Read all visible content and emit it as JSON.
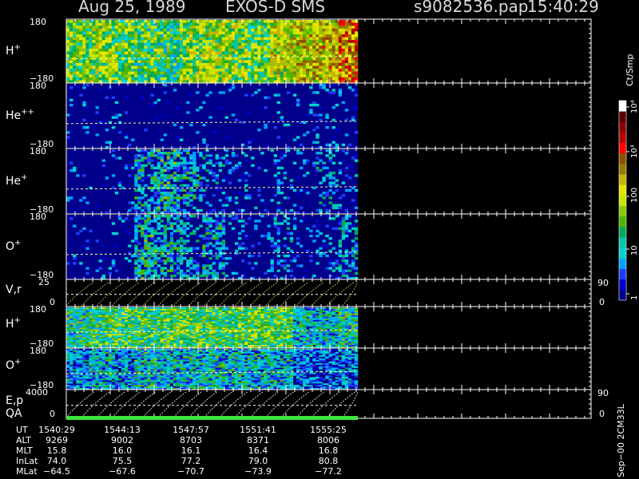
{
  "header": {
    "date": "Aug 25, 1989",
    "instrument": "EXOS-D SMS",
    "filename": "s9082536.pap",
    "time": "15:40:29"
  },
  "colorbar": {
    "unit": "Ct/Smp",
    "ticks": [
      "1",
      "10",
      "100",
      "10³",
      "10⁴"
    ],
    "colors": [
      "#00008b",
      "#0000cd",
      "#1e3cff",
      "#00a0ff",
      "#00d2d2",
      "#00c8aa",
      "#00aa5a",
      "#50b400",
      "#8cc800",
      "#c8e600",
      "#e6e600",
      "#c8b400",
      "#967800",
      "#8c5000",
      "#ff0000",
      "#b40000",
      "#8b0000",
      "#5a0000",
      "#ffffff"
    ]
  },
  "panels": [
    {
      "id": "h-plus",
      "label": "H",
      "sup": "+",
      "ytop": "180",
      "ybot": "−180"
    },
    {
      "id": "he-plus-plus",
      "label": "He",
      "sup": "++",
      "ytop": "180",
      "ybot": "−180"
    },
    {
      "id": "he-plus",
      "label": "He",
      "sup": "+",
      "ytop": "180",
      "ybot": "−180"
    },
    {
      "id": "o-plus",
      "label": "O",
      "sup": "+",
      "ytop": "180",
      "ybot": "−180"
    },
    {
      "id": "vr",
      "label": "V,r",
      "sup": "",
      "ytop": "25",
      "ybot": "0",
      "right_top": "90",
      "right_bot": "0"
    },
    {
      "id": "h-plus-2",
      "label": "H",
      "sup": "+",
      "ytop": "180",
      "ybot": "−180"
    },
    {
      "id": "o-plus-2",
      "label": "O",
      "sup": "+",
      "ytop": "180",
      "ybot": "−180"
    },
    {
      "id": "ep",
      "label": "E,p",
      "sup": "",
      "ytop": "4000",
      "ybot": "0",
      "right_top": "90",
      "right_bot": "0"
    }
  ],
  "qa_label": "QA",
  "orbit_table": {
    "labels": [
      "UT",
      "ALT",
      "MLT",
      "InLat",
      "MLat"
    ],
    "columns": [
      [
        "1540:29",
        "9269",
        "15.8",
        "74.0",
        "−64.5"
      ],
      [
        "1544:13",
        "9002",
        "16.0",
        "75.5",
        "−67.6"
      ],
      [
        "1547:57",
        "8703",
        "16.1",
        "77.2",
        "−70.7"
      ],
      [
        "1551:41",
        "8371",
        "16.4",
        "79.0",
        "−73.9"
      ],
      [
        "1555:25",
        "8006",
        "16.8",
        "80.8",
        "−77.2"
      ]
    ]
  },
  "footer_vertical": "Sep−00 2CM33L",
  "chart_data": {
    "type": "heatmap",
    "title": "Aug 25, 1989   EXOS-D SMS",
    "x_tick_labels_ut": [
      "1540:29",
      "1544:13",
      "1547:57",
      "1551:41",
      "1555:25"
    ],
    "panels": [
      {
        "name": "H+",
        "ylim": [
          -180,
          180
        ],
        "relative_intensity": [
          0.55,
          0.6,
          0.55,
          0.5,
          0.45,
          0.6,
          0.65,
          0.6,
          0.55,
          0.7,
          0.75,
          0.8,
          0.95
        ]
      },
      {
        "name": "He++",
        "ylim": [
          -180,
          180
        ],
        "relative_intensity": [
          0.05,
          0.05,
          0.06,
          0.05,
          0.05,
          0.05,
          0.06,
          0.05,
          0.05,
          0.06,
          0.1,
          0.12,
          0.1
        ]
      },
      {
        "name": "He+",
        "ylim": [
          -180,
          180
        ],
        "relative_intensity": [
          0.05,
          0.05,
          0.1,
          0.3,
          0.35,
          0.3,
          0.2,
          0.15,
          0.1,
          0.15,
          0.1,
          0.2,
          0.1
        ]
      },
      {
        "name": "O+",
        "ylim": [
          -180,
          180
        ],
        "relative_intensity": [
          0.05,
          0.05,
          0.1,
          0.35,
          0.3,
          0.25,
          0.3,
          0.15,
          0.1,
          0.2,
          0.1,
          0.15,
          0.25
        ]
      },
      {
        "name": "H+ (2)",
        "ylim": [
          -180,
          180
        ],
        "relative_intensity": [
          0.4,
          0.45,
          0.5,
          0.45,
          0.5,
          0.55,
          0.5,
          0.5,
          0.55,
          0.5,
          0.3,
          0.3,
          0.4
        ]
      },
      {
        "name": "O+ (2)",
        "ylim": [
          -180,
          180
        ],
        "relative_intensity": [
          0.2,
          0.3,
          0.25,
          0.35,
          0.3,
          0.3,
          0.35,
          0.3,
          0.3,
          0.3,
          0.15,
          0.15,
          0.2
        ]
      }
    ],
    "colorbar_scale": "log",
    "colorbar_range": [
      1,
      10000
    ]
  }
}
